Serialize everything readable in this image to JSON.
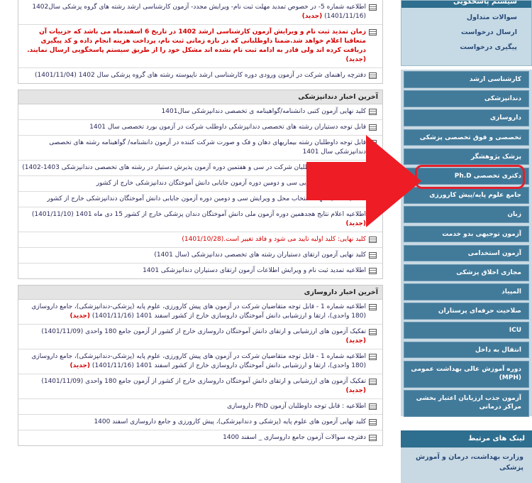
{
  "sidebar": {
    "top_title": "سیستم پاسخگویی",
    "top_links": [
      "سوالات متداول",
      "ارسال درخواست",
      "پیگیری درخواست"
    ],
    "menu": [
      "کارشناسی ارشد",
      "دندانپزشکی",
      "داروسازی",
      "تخصصی و فوق تخصصی پزشکی",
      "پزشک پژوهشگر",
      "دکتری تخصصی Ph.D",
      "جامع علوم پایه/پیش کارورزی",
      "زبان",
      "آزمون توجیهی بدو خدمت",
      "آزمون استخدامی",
      "مجازی اخلاق پزشکی",
      "المپیاد",
      "صلاحیت حرفه‌ای پرستاران",
      "ICU",
      "انتقال به داخل",
      "دوره آموزش عالی بهداشت عمومی (MPH)",
      "آزمون جذب ارزیابان اعتبار بخشی مراکز درمانی"
    ],
    "links_title": "لینک های مرتبط",
    "links": [
      "وزارت بهداشت، درمان و آموزش پزشکی"
    ]
  },
  "top_panel": {
    "items": [
      {
        "text": "اطلاعیه شماره 5- در خصوص تمدید مهلت ثبت نام- ویرایش مجدد- آزمون کارشناسی ارشد رشته های گروه پزشکی سال1402 (1401/11/16)",
        "new": "(جدید)"
      },
      {
        "text": "زمان تمدید ثبت نام و ویرایش آزمون کارشناسی ارشد 1402 در تاریخ 6 اسفندماه می باشد که جزییات آن متعاقبا اعلام خواهد شد.ضمنا داوطلبانی که در بازه زمانی ثبت نام، پرداخت هزینه انجام داده و کد پیگیری دریافت کرده اند ولی قادر به ادامه ثبت نام نشده اند مشکل خود را از طریق سیستم پاسخگویی ارسال نمایند.",
        "new": "(جدید)"
      },
      {
        "text": "دفترچه راهنمای شرکت در آزمون ورودی دوره کارشناسی ارشد ناپیوسته رشته های گروه پزشکی سال 1402 (1401/11/04)",
        "new": ""
      }
    ]
  },
  "dental_panel": {
    "title": "آخرین اخبار دندانپزشکی",
    "items": [
      {
        "text": "کلید نهایی آزمون کتبی دانشنامه/گواهینامه ی تخصصی دندانپزشکی سال1401",
        "new": ""
      },
      {
        "text": "قابل توجه دستیاران رشته های تخصصی دندانپزشکی داوطلب شرکت در آزمون بورد تخصصی سال 1401",
        "new": ""
      },
      {
        "text": "قابل توجه داوطلبان رشته بیماریهای دهان و فک و صورت شرکت کننده در آزمون دانشنامه/ گواهینامه رشته های تخصصی دندانپزشکی سال 1401",
        "new": ""
      },
      {
        "text": "شرایط اختصاصی داوطلبان شرکت در سی و هفتمین دوره آزمون پذیرش دستیار در رشته های تخصصی دندانپزشکی 1403-1402)",
        "new": ""
      },
      {
        "text": "اطلاعیه- اعلام نتایج نهایی سی و دومین دوره آزمون جایابی دانش آموختگان دندانپزشکی خارج از کشور",
        "new": ""
      },
      {
        "text": "اطلاعیه- تمدید مهلت انتخاب محل و ویرایش سی و دومین دوره آزمون جایابی دانش آموختگان دندانپزشکی خارج از کشور",
        "new": ""
      },
      {
        "text": "اطلاعیه اعلام نتایج هجدهمین دوره آزمون ملی دانش آموختگان دندان پزشکی خارج از کشور 15 دی ماه 1401 (1401/11/10)",
        "new": "(جدید)"
      },
      {
        "text": "کلید نهایی: کلید اولیه تایید می شود و فاقد تغییر است.(1401/10/28)",
        "new": ""
      },
      {
        "text": "کلید نهایی آزمون ارتقای دستیاران رشته های تخصصی دندانپزشکی (سال 1401)",
        "new": ""
      },
      {
        "text": "اطلاعیه تمدید ثبت نام و ویرایش اطلاعات آزمون ارتقای دستیاران دندانپزشکی 1401",
        "new": ""
      }
    ]
  },
  "pharmacy_panel": {
    "title": "آخرین اخبار داروسازی",
    "items": [
      {
        "text": "اطلاعیه شماره 1 - قابل توجه متقاضیان شرکت در آزمون های پیش کارورزی، علوم پایه (پزشکی-دندانپزشکی)، جامع داروسازی (180 واحدی)، ارتقا و ارزشیابی دانش آموختگان داروسازی خارج از کشور اسفند 1401 (1401/11/16)",
        "new": "(جدید)"
      },
      {
        "text": "تفکیک آزمون های ارزشیابی و ارتقای دانش آموختگان داروسازی خارج از کشور از آزمون جامع 180 واحدی (1401/11/09)",
        "new": "(جدید)"
      },
      {
        "text": "اطلاعیه شماره 1 - قابل توجه متقاضیان شرکت در آزمون های پیش کارورزی، علوم پایه (پزشکی-دندانپزشکی)، جامع داروسازی (180 واحدی)، ارتقا و ارزشیابی دانش آموختگان داروسازی خارج از کشور اسفند 1401 (1401/11/16)",
        "new": "(جدید)"
      },
      {
        "text": "تفکیک آزمون های ارزشیابی و ارتقای دانش آموختگان داروسازی خارج از کشور از آزمون جامع 180 واحدی (1401/11/09)",
        "new": "(جدید)"
      },
      {
        "text": "اطلاعیه : قابل توجه داوطلبان آزمون PhD داروسازی",
        "new": ""
      },
      {
        "text": "کلید نهایی آزمون های علوم پایه (پزشکی و دندانپزشکی)، پیش کارورزی و جامع داروسازی اسفند 1400",
        "new": ""
      },
      {
        "text": "دفترچه سوالات آزمون جامع داروسازی _ اسفند 1400",
        "new": ""
      }
    ]
  },
  "colors": {
    "accent": "#427a9a",
    "highlight": "#e2202c",
    "new_label": "#d40000"
  }
}
